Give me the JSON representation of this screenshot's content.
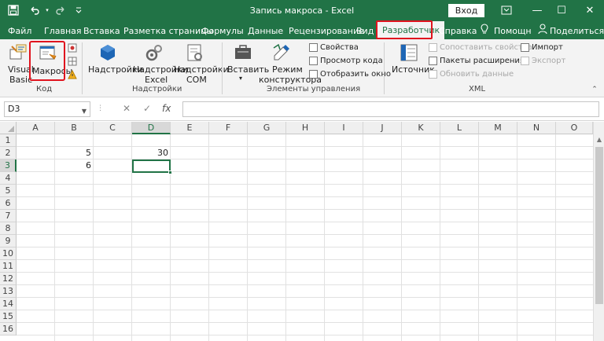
{
  "titlebar": {
    "title": "Запись макроса  -  Excel",
    "login_label": "Вход",
    "save_icon": "save-icon",
    "undo_icon": "undo-icon",
    "redo_icon": "redo-icon",
    "customize_icon": "customize-qat-icon",
    "minimize": "—",
    "maximize": "☐",
    "close": "✕",
    "ribbon_options": "ribbon-display-options-icon"
  },
  "tabs": [
    {
      "label": "Файл"
    },
    {
      "label": "Главная"
    },
    {
      "label": "Вставка"
    },
    {
      "label": "Разметка страницы"
    },
    {
      "label": "Формулы"
    },
    {
      "label": "Данные"
    },
    {
      "label": "Рецензирование"
    },
    {
      "label": "Вид"
    },
    {
      "label": "Разработчик",
      "active": true
    },
    {
      "label": "Справка"
    },
    {
      "label": "Помощн"
    },
    {
      "label": "Поделиться"
    }
  ],
  "ribbon": {
    "code_group": {
      "label": "Код",
      "visual_basic_line1": "Visual",
      "visual_basic_line2": "Basic",
      "macros": "Макросы"
    },
    "addins_group": {
      "label": "Надстройки",
      "addins": "Надстройки",
      "excel_addins_line1": "Надстройки",
      "excel_addins_line2": "Excel",
      "com_addins_line1": "Надстройки",
      "com_addins_line2": "COM"
    },
    "controls_group": {
      "label": "Элементы управления",
      "insert": "Вставить",
      "design_mode_line1": "Режим",
      "design_mode_line2": "конструктора",
      "properties": "Свойства",
      "view_code": "Просмотр кода",
      "run_dialog": "Отобразить окно"
    },
    "xml_group": {
      "label": "XML",
      "source": "Источник",
      "map_properties": "Сопоставить свойства",
      "expansion_packs": "Пакеты расширения",
      "refresh_data": "Обновить данные",
      "import": "Импорт",
      "export": "Экспорт"
    }
  },
  "formula_bar": {
    "name_box": "D3",
    "cancel": "✕",
    "enter": "✓",
    "fx": "fx",
    "formula": ""
  },
  "grid": {
    "columns": [
      "A",
      "B",
      "C",
      "D",
      "E",
      "F",
      "G",
      "H",
      "I",
      "J",
      "K",
      "L",
      "M",
      "N",
      "O"
    ],
    "rows": [
      "1",
      "2",
      "3",
      "4",
      "5",
      "6",
      "7",
      "8",
      "9",
      "10",
      "11",
      "12",
      "13",
      "14",
      "15",
      "16"
    ],
    "cells": {
      "B2": "5",
      "D2": "30",
      "B3": "6"
    },
    "active_cell": "D3"
  },
  "colors": {
    "brand": "#217346",
    "highlight": "#e0141e"
  }
}
